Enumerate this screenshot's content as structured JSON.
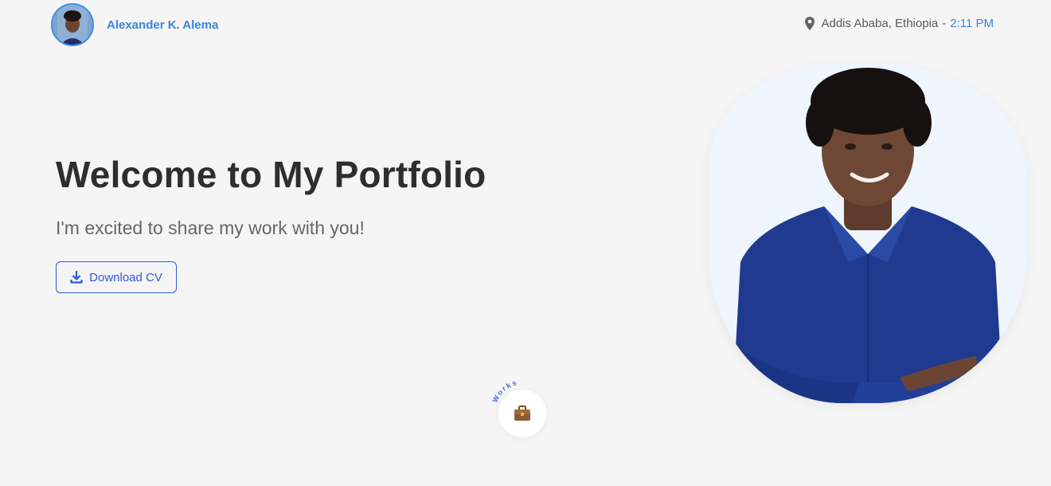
{
  "header": {
    "name": "Alexander K. Alema",
    "location": "Addis Ababa, Ethiopia",
    "separator": "-",
    "time": "2:11 PM"
  },
  "hero": {
    "title": "Welcome to My Portfolio",
    "subtitle": "I'm excited to share my work with you!",
    "cv_button_label": "Download CV"
  },
  "works": {
    "label": "Works",
    "icon": "briefcase-icon"
  },
  "colors": {
    "accent": "#3a86de",
    "button": "#2f5bd6",
    "background": "#f5f5f5",
    "shirt": "#1f3a8f"
  }
}
